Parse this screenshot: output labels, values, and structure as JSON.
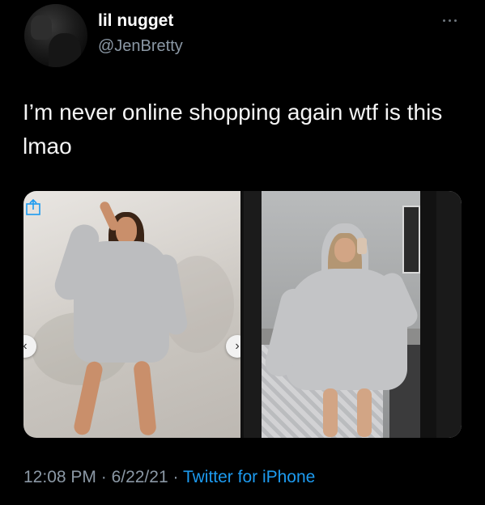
{
  "user": {
    "display_name": "lil nugget",
    "handle": "@JenBretty"
  },
  "tweet": {
    "text": "I’m never online shopping again wtf is this lmao"
  },
  "media": {
    "count": 2,
    "prev_arrow": "‹",
    "next_arrow": "›",
    "share_icon": "share-icon"
  },
  "meta": {
    "time": "12:08 PM",
    "separator1": " · ",
    "date": "6/22/21",
    "separator2": " · ",
    "source": "Twitter for iPhone"
  },
  "colors": {
    "background": "#000000",
    "text": "#e7e9ea",
    "muted": "#8b98a5",
    "link": "#1d9bf0"
  }
}
